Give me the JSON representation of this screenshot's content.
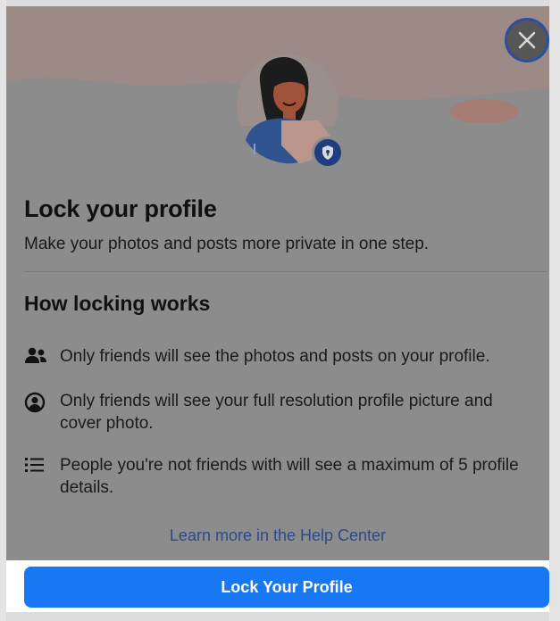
{
  "dialog": {
    "title": "Lock your profile",
    "subtitle": "Make your photos and posts more private in one step.",
    "section_title": "How locking works",
    "items": [
      {
        "icon": "friends-icon",
        "text": "Only friends will see the photos and posts on your profile."
      },
      {
        "icon": "profile-circle-icon",
        "text": "Only friends will see your full resolution profile picture and cover photo."
      },
      {
        "icon": "list-icon",
        "text": "People you're not friends with will see a maximum of 5 profile details."
      }
    ],
    "help_link": "Learn more in the Help Center",
    "cta_label": "Lock Your Profile",
    "close_icon": "close-icon"
  },
  "colors": {
    "primary": "#1877f2",
    "link": "#2a4a8e",
    "overlay": "#8c8c8c"
  }
}
